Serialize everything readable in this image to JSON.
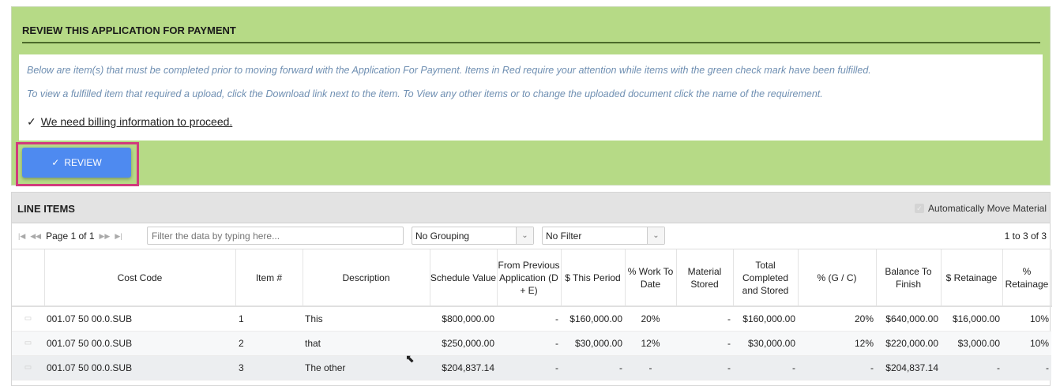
{
  "review": {
    "title": "REVIEW THIS APPLICATION FOR PAYMENT",
    "line1": "Below are item(s) that must be completed prior to moving forward with the Application For Payment. Items in Red require your attention while items with the green check mark have been fulfilled.",
    "line2": "To view a fulfilled item that required a upload, click the Download link next to the item. To View any other items or to change the uploaded document click the name of the requirement.",
    "requirement": "We need billing information to proceed.",
    "button": "REVIEW"
  },
  "line_items": {
    "title": "LINE ITEMS",
    "auto_move": "Automatically Move Material",
    "page": "Page 1 of 1",
    "filter_placeholder": "Filter the data by typing here...",
    "grouping": "No Grouping",
    "filter": "No Filter",
    "count": "1 to 3 of 3",
    "columns": [
      "",
      "Cost Code",
      "Item #",
      "Description",
      "Schedule Value",
      "From Previous Application (D + E)",
      "$ This Period",
      "% Work To Date",
      "Material Stored",
      "Total Completed and Stored",
      "% (G / C)",
      "Balance To Finish",
      "$ Retainage",
      "% Retainage"
    ],
    "rows": [
      [
        "001.07 50 00.0.SUB",
        "1",
        "This",
        "$800,000.00",
        "-",
        "$160,000.00",
        "20%",
        "-",
        "$160,000.00",
        "20%",
        "$640,000.00",
        "$16,000.00",
        "10%"
      ],
      [
        "001.07 50 00.0.SUB",
        "2",
        "that",
        "$250,000.00",
        "-",
        "$30,000.00",
        "12%",
        "-",
        "$30,000.00",
        "12%",
        "$220,000.00",
        "$3,000.00",
        "10%"
      ],
      [
        "001.07 50 00.0.SUB",
        "3",
        "The other",
        "$204,837.14",
        "-",
        "-",
        "-",
        "-",
        "-",
        "-",
        "$204,837.14",
        "-",
        "-"
      ]
    ]
  }
}
